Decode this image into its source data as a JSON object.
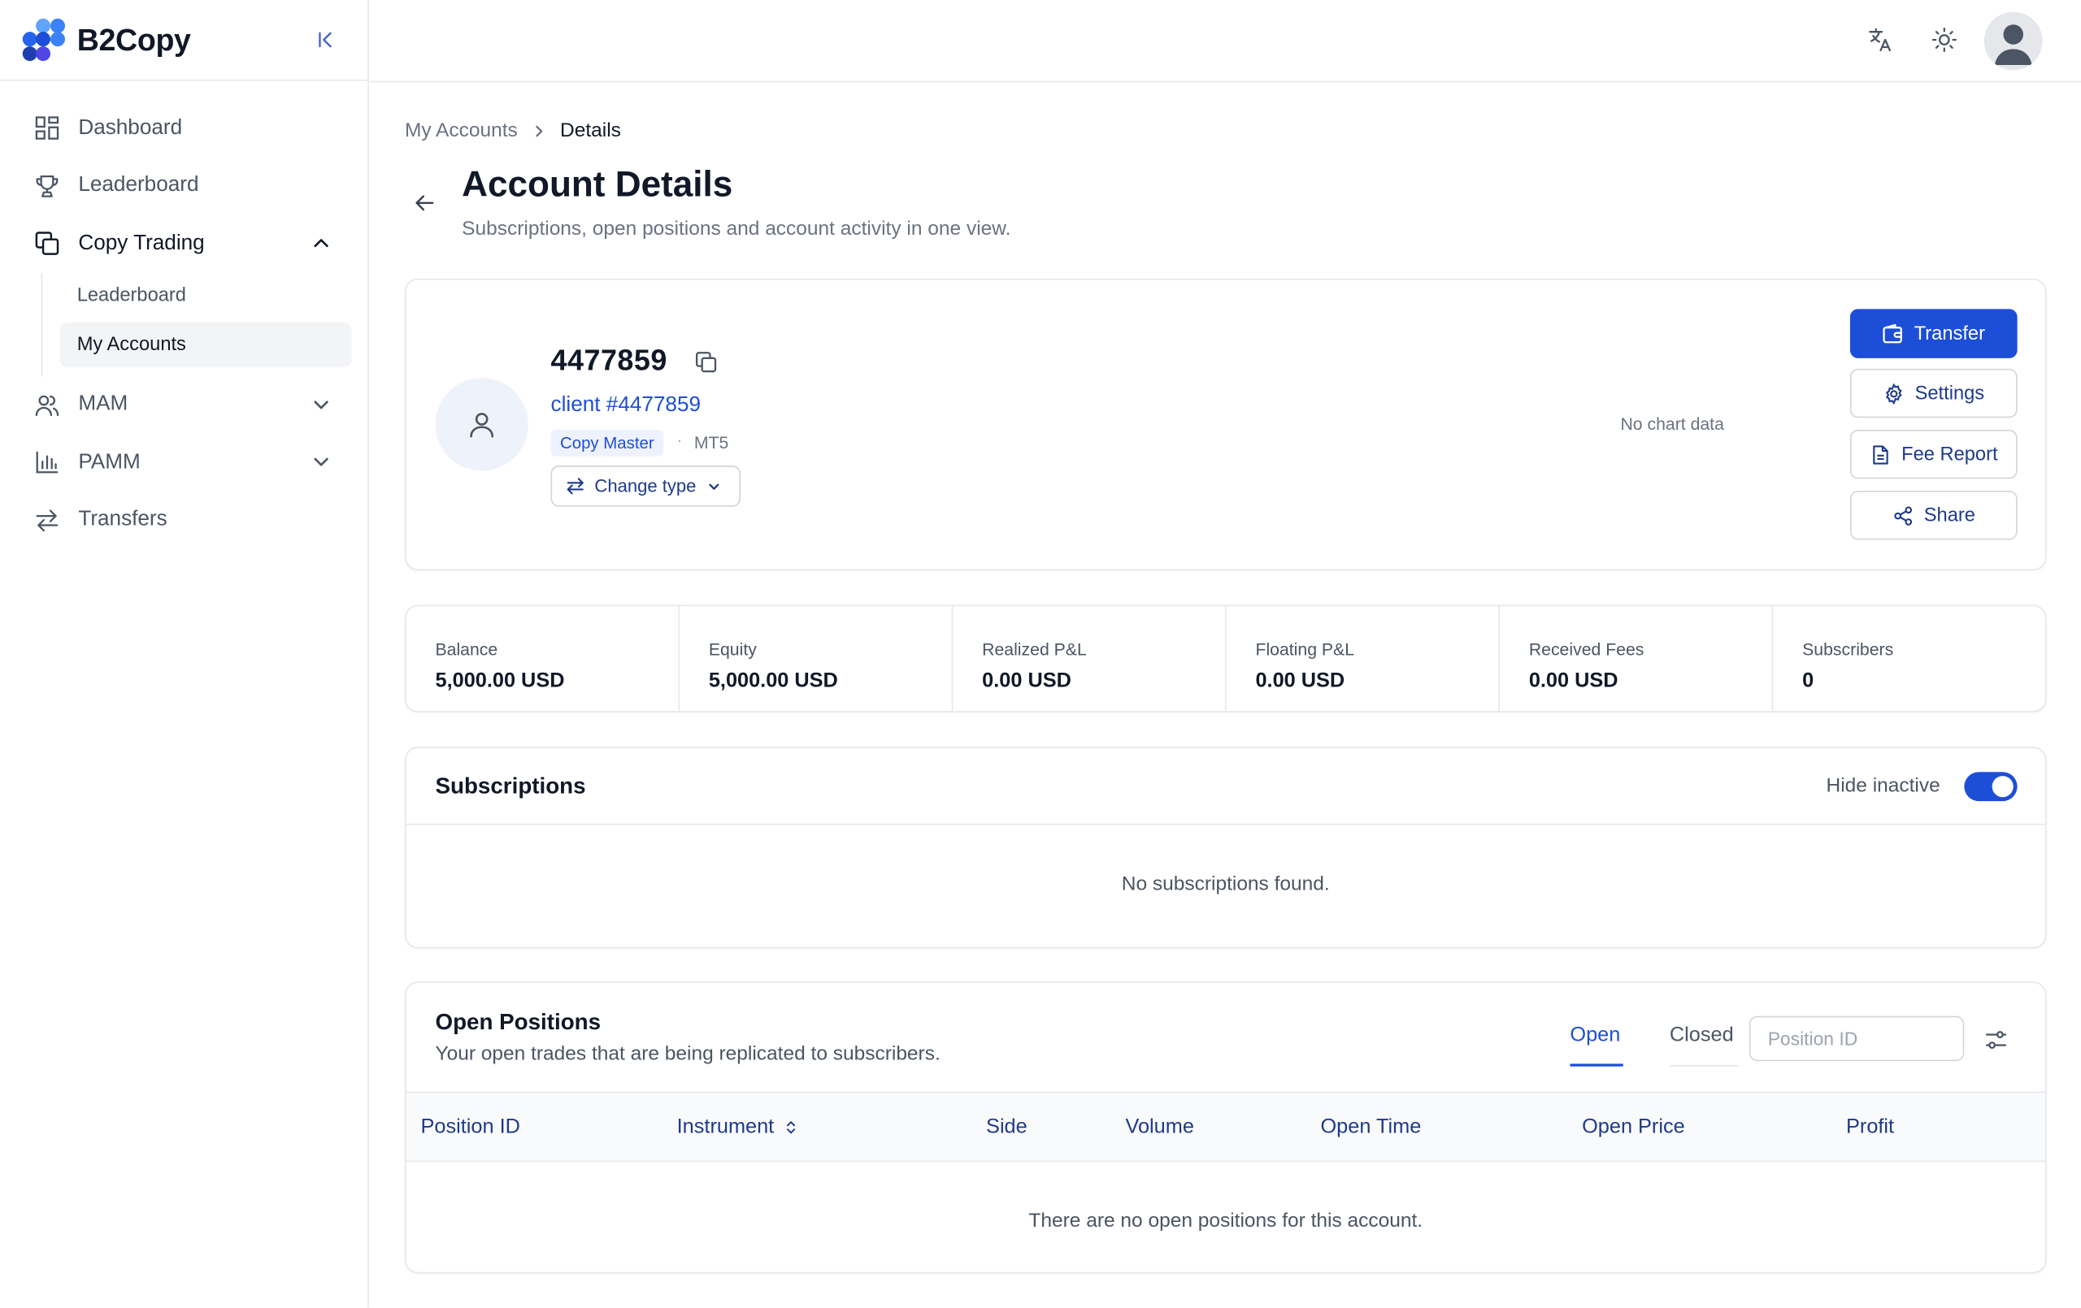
{
  "app": {
    "name": "B2Copy"
  },
  "sidebar": {
    "items": [
      {
        "label": "Dashboard",
        "icon": "dashboard-icon"
      },
      {
        "label": "Leaderboard",
        "icon": "trophy-icon"
      },
      {
        "label": "Copy Trading",
        "icon": "copy-trading-icon",
        "expanded": true,
        "children": [
          {
            "label": "Leaderboard"
          },
          {
            "label": "My Accounts",
            "active": true
          }
        ]
      },
      {
        "label": "MAM",
        "icon": "users-icon",
        "expanded": false
      },
      {
        "label": "PAMM",
        "icon": "bar-chart-icon",
        "expanded": false
      },
      {
        "label": "Transfers",
        "icon": "transfer-arrows-icon"
      }
    ]
  },
  "topbar": {
    "icons": [
      "translate-icon",
      "sun-icon",
      "user-avatar"
    ]
  },
  "breadcrumb": {
    "parent": "My Accounts",
    "current": "Details"
  },
  "page": {
    "title": "Account Details",
    "subtitle": "Subscriptions, open positions and account activity in one view."
  },
  "account": {
    "number": "4477859",
    "client": "client #4477859",
    "badge": "Copy Master",
    "dot": "·",
    "platform": "MT5",
    "change_type_label": "Change type",
    "chart_empty": "No chart data",
    "actions": {
      "transfer": "Transfer",
      "settings": "Settings",
      "fee_report": "Fee Report",
      "share": "Share"
    }
  },
  "stats": [
    {
      "label": "Balance",
      "value": "5,000.00 USD"
    },
    {
      "label": "Equity",
      "value": "5,000.00 USD"
    },
    {
      "label": "Realized P&L",
      "value": "0.00 USD"
    },
    {
      "label": "Floating P&L",
      "value": "0.00 USD"
    },
    {
      "label": "Received Fees",
      "value": "0.00 USD"
    },
    {
      "label": "Subscribers",
      "value": "0"
    }
  ],
  "subscriptions": {
    "title": "Subscriptions",
    "hide_inactive_label": "Hide inactive",
    "hide_inactive": true,
    "empty": "No subscriptions found."
  },
  "positions": {
    "title": "Open Positions",
    "subtitle": "Your open trades that are being replicated to subscribers.",
    "tabs": {
      "open": "Open",
      "closed": "Closed",
      "active": "Open"
    },
    "search_placeholder": "Position ID",
    "columns": [
      "Position ID",
      "Instrument",
      "Side",
      "Volume",
      "Open Time",
      "Open Price",
      "Profit"
    ],
    "empty": "There are no open positions for this account."
  },
  "colors": {
    "accent": "#1d4ed8",
    "logo_dots": [
      "#60a5fa",
      "#3b82f6",
      "#1d4ed8",
      "#2563eb",
      "#1e40af",
      "#4f46e5"
    ]
  }
}
